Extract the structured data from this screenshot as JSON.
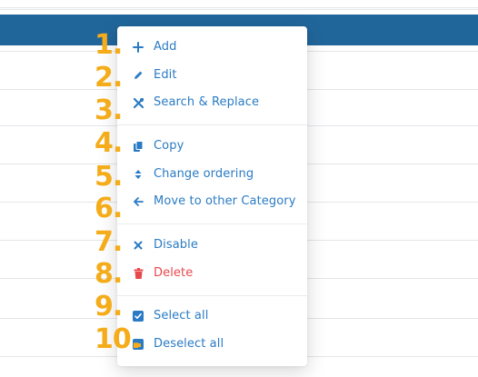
{
  "colors": {
    "header": "#21669b",
    "menu_text": "#2a7bc4",
    "danger": "#e8484c",
    "callout_numbers": "#f4ac1a"
  },
  "context_menu": {
    "items": [
      {
        "label": "Add",
        "icon": "plus-icon"
      },
      {
        "label": "Edit",
        "icon": "pencil-icon"
      },
      {
        "label": "Search & Replace",
        "icon": "tools-icon"
      },
      {
        "label": "Copy",
        "icon": "copy-icon"
      },
      {
        "label": "Change ordering",
        "icon": "sort-icon"
      },
      {
        "label": "Move to other Category",
        "icon": "arrow-left-icon"
      },
      {
        "label": "Disable",
        "icon": "x-icon"
      },
      {
        "label": "Delete",
        "icon": "trash-icon"
      },
      {
        "label": "Select all",
        "icon": "checkbox-checked-icon"
      },
      {
        "label": "Deselect all",
        "icon": "checkbox-partial-icon"
      }
    ]
  },
  "callouts": [
    "1.",
    "2.",
    "3.",
    "4.",
    "5.",
    "6.",
    "7.",
    "8.",
    "9.",
    "10."
  ]
}
